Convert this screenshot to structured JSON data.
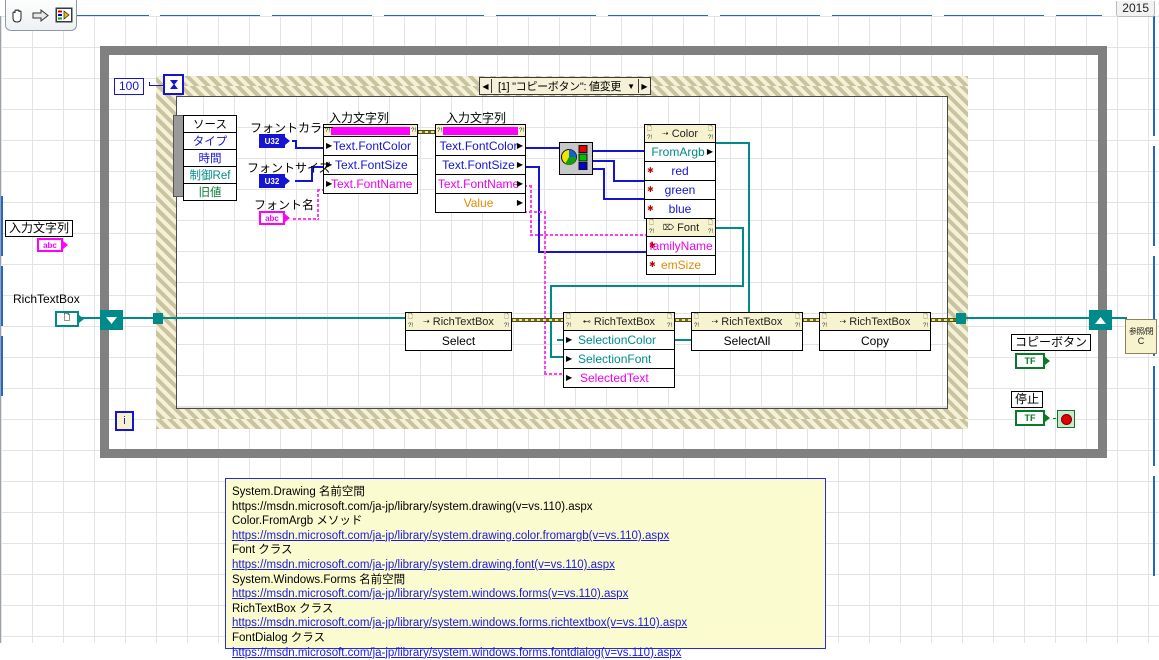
{
  "window": {
    "version_label": "2015",
    "toolbar": [
      {
        "name": "hand-tool-icon",
        "glyph": "✋"
      },
      {
        "name": "arrow-right-icon",
        "glyph": "➡"
      },
      {
        "name": "vi-connector-icon",
        "glyph": "▦"
      }
    ]
  },
  "loop": {
    "timeout_constant": "100",
    "iteration_terminal": "i",
    "timeout_terminal_icon": "hourglass-icon"
  },
  "event_structure": {
    "case_label": "[1] \"コピーボタン\": 値変更",
    "left_arrow": "◀",
    "right_arrow": "▶",
    "chevron": "▼",
    "event_data_node": {
      "rows": [
        "ソース",
        "タイプ",
        "時間",
        "制御Ref",
        "旧値"
      ]
    }
  },
  "controls": {
    "font_color": {
      "label": "フォントカラー",
      "type": "U32"
    },
    "font_size": {
      "label": "フォントサイズ",
      "type": "U32"
    },
    "font_name": {
      "label": "フォント名",
      "type": "abc"
    },
    "input_string_left": {
      "label": "入力文字列",
      "type": "abc"
    },
    "rich_text_box": {
      "label": "RichTextBox"
    },
    "copy_button": {
      "label": "コピーボタン",
      "type": "TF"
    },
    "stop_button": {
      "label": "停止",
      "type": "TF"
    }
  },
  "nodes": {
    "prop_input_string_read": {
      "title": "入力文字列",
      "rows": [
        "Text.FontColor",
        "Text.FontSize",
        "Text.FontName"
      ]
    },
    "prop_input_string_write": {
      "title": "入力文字列",
      "rows": [
        "Text.FontColor",
        "Text.FontSize",
        "Text.FontName",
        "Value"
      ]
    },
    "color_node": {
      "title": "Color",
      "method": "FromArgb",
      "inputs": [
        "red",
        "green",
        "blue"
      ]
    },
    "font_node": {
      "title": "Font",
      "inputs": [
        "familyName",
        "emSize"
      ]
    },
    "richtextbox_select": {
      "title": "RichTextBox",
      "method": "Select"
    },
    "richtextbox_props": {
      "title": "RichTextBox",
      "rows": [
        "SelectionColor",
        "SelectionFont",
        "SelectedText"
      ]
    },
    "richtextbox_selectall": {
      "title": "RichTextBox",
      "method": "SelectAll"
    },
    "richtextbox_copy": {
      "title": "RichTextBox",
      "method": "Copy"
    },
    "color_to_rgb": {
      "name": "color-to-rgb-icon"
    },
    "close_reference": {
      "label_top": "参照/閉",
      "label_bottom": "C"
    }
  },
  "comment": {
    "lines": [
      {
        "text": "System.Drawing 名前空間",
        "link": false
      },
      {
        "text": "https://msdn.microsoft.com/ja-jp/library/system.drawing(v=vs.110).aspx",
        "link": false
      },
      {
        "text": "Color.FromArgb メソッド",
        "link": false
      },
      {
        "text": "https://msdn.microsoft.com/ja-jp/library/system.drawing.color.fromargb(v=vs.110).aspx",
        "link": true
      },
      {
        "text": "Font クラス",
        "link": false
      },
      {
        "text": "https://msdn.microsoft.com/ja-jp/library/system.drawing.font(v=vs.110).aspx",
        "link": true
      },
      {
        "text": "System.Windows.Forms 名前空間",
        "link": false
      },
      {
        "text": "https://msdn.microsoft.com/ja-jp/library/system.windows.forms(v=vs.110).aspx",
        "link": true
      },
      {
        "text": "RichTextBox クラス",
        "link": false
      },
      {
        "text": "https://msdn.microsoft.com/ja-jp/library/system.windows.forms.richtextbox(v=vs.110).aspx",
        "link": true
      },
      {
        "text": "FontDialog クラス",
        "link": false
      },
      {
        "text": "https://msdn.microsoft.com/ja-jp/library/system.windows.forms.fontdialog(v=vs.110).aspx",
        "link": true
      }
    ]
  },
  "colors": {
    "wire_blue": "#1414d2",
    "wire_teal": "#008b8b",
    "wire_pink": "#ff3df5",
    "wire_green": "#0a7a28",
    "loop_border": "#808080",
    "node_header": "#f7f3cf",
    "comment_bg": "#fbfbd0"
  }
}
